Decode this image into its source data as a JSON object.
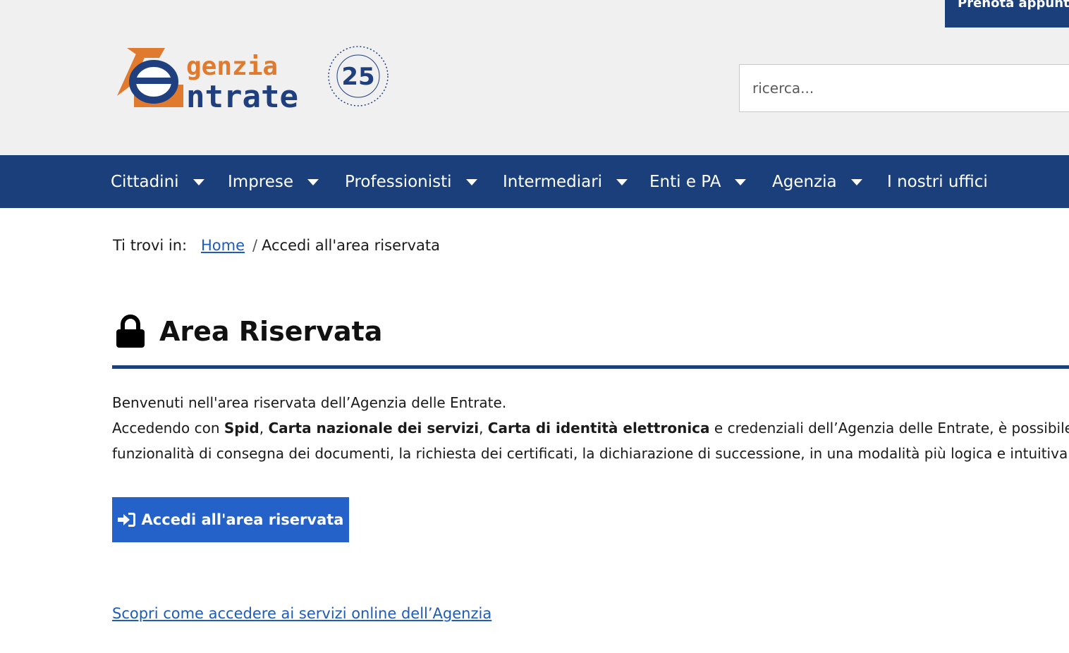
{
  "header": {
    "prenota_label": "Prenota appuntamento",
    "logo_text_1": "genzia",
    "logo_text_2": "ntrate",
    "seal_number": "25",
    "search_placeholder": "ricerca..."
  },
  "nav": {
    "items": [
      {
        "label": "Cittadini"
      },
      {
        "label": "Imprese"
      },
      {
        "label": "Professionisti"
      },
      {
        "label": "Intermediari"
      },
      {
        "label": "Enti e PA"
      },
      {
        "label": "Agenzia"
      },
      {
        "label": "I nostri uffici"
      }
    ]
  },
  "breadcrumb": {
    "prefix": "Ti trovi in:",
    "home": "Home",
    "separator": "/",
    "current": "Accedi all'area riservata"
  },
  "page": {
    "title": "Area Riservata",
    "line1": "Benvenuti nell'area riservata dell’Agenzia delle Entrate.",
    "line2_a": "Accedendo con ",
    "line2_b1": "Spid",
    "line2_c1": ", ",
    "line2_b2": "Carta nazionale dei servizi",
    "line2_c2": ", ",
    "line2_b3": "Carta di identità elettronica",
    "line2_d": " e credenziali dell’Agenzia delle Entrate, è possibile utilizzare",
    "line3": "funzionalità di consegna dei documenti, la richiesta dei certificati, la dichiarazione di successione, in una modalità più logica e intuitiva.",
    "cta_label": "Accedi all'area riservata",
    "discover_link": "Scopri come accedere ai servizi online dell’Agenzia"
  },
  "colors": {
    "brand_blue": "#1a3f7a",
    "button_blue": "#2461c9",
    "link_blue": "#1f5bb8",
    "logo_orange": "#e07a2e",
    "logo_navy": "#1f3f7f"
  }
}
